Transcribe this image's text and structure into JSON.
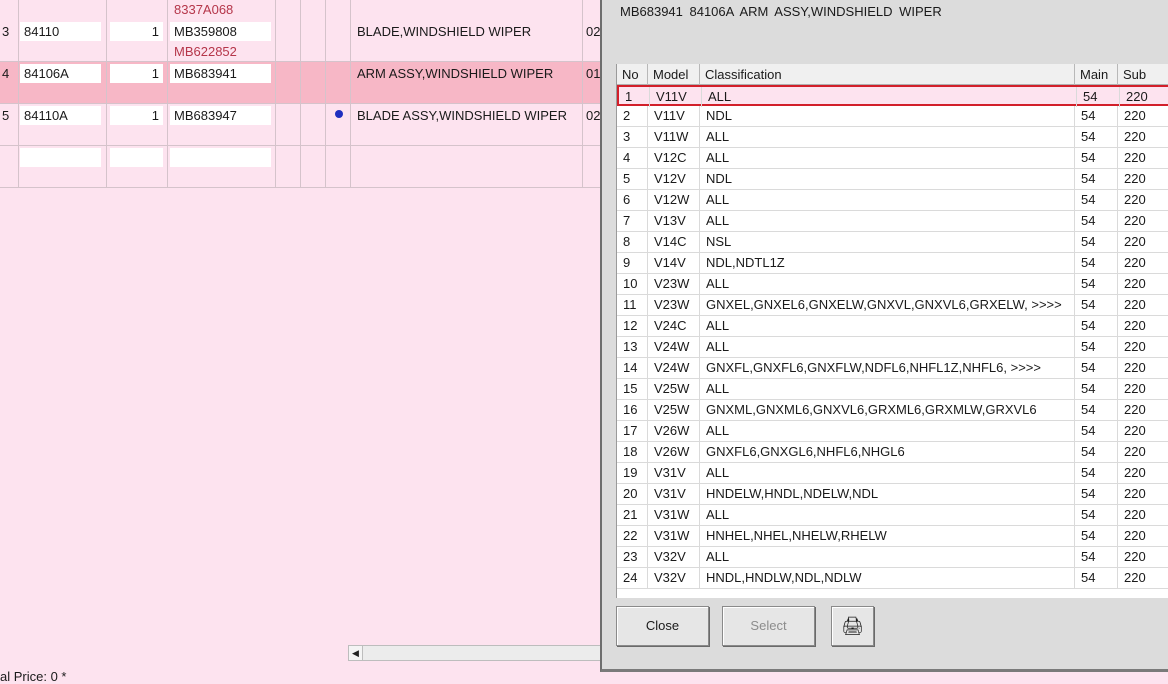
{
  "parts_grid": {
    "top_alternates": [
      "8337A068"
    ],
    "rows": [
      {
        "no": "3",
        "part_code": "84110",
        "qty": "1",
        "part_number": "MB359808",
        "alternates": [
          "MB622852"
        ],
        "has_marker": false,
        "description": "BLADE,WINDSHIELD WIPER",
        "trailing": "02",
        "selected": false
      },
      {
        "no": "4",
        "part_code": "84106A",
        "qty": "1",
        "part_number": "MB683941",
        "alternates": [],
        "has_marker": false,
        "description": "ARM ASSY,WINDSHIELD WIPER",
        "trailing": "01",
        "selected": true
      },
      {
        "no": "5",
        "part_code": "84110A",
        "qty": "1",
        "part_number": "MB683947",
        "alternates": [],
        "has_marker": true,
        "description": "BLADE ASSY,WINDSHIELD WIPER",
        "trailing": "02",
        "selected": false
      },
      {
        "no": "",
        "part_code": "",
        "qty": "",
        "part_number": "",
        "alternates": [],
        "has_marker": false,
        "description": "",
        "trailing": "",
        "selected": false
      }
    ]
  },
  "footer": {
    "total_price": "al Price: 0 *"
  },
  "dialog": {
    "header": "MB683941   84106A   ARM ASSY,WINDSHIELD WIPER",
    "columns": {
      "no": "No",
      "model": "Model",
      "classification": "Classification",
      "main": "Main",
      "sub": "Sub"
    },
    "rows": [
      {
        "no": "1",
        "model": "V11V",
        "classification": "ALL",
        "main": "54",
        "sub": "220"
      },
      {
        "no": "2",
        "model": "V11V",
        "classification": "NDL",
        "main": "54",
        "sub": "220"
      },
      {
        "no": "3",
        "model": "V11W",
        "classification": "ALL",
        "main": "54",
        "sub": "220"
      },
      {
        "no": "4",
        "model": "V12C",
        "classification": "ALL",
        "main": "54",
        "sub": "220"
      },
      {
        "no": "5",
        "model": "V12V",
        "classification": "NDL",
        "main": "54",
        "sub": "220"
      },
      {
        "no": "6",
        "model": "V12W",
        "classification": "ALL",
        "main": "54",
        "sub": "220"
      },
      {
        "no": "7",
        "model": "V13V",
        "classification": "ALL",
        "main": "54",
        "sub": "220"
      },
      {
        "no": "8",
        "model": "V14C",
        "classification": "NSL",
        "main": "54",
        "sub": "220"
      },
      {
        "no": "9",
        "model": "V14V",
        "classification": "NDL,NDTL1Z",
        "main": "54",
        "sub": "220"
      },
      {
        "no": "10",
        "model": "V23W",
        "classification": "ALL",
        "main": "54",
        "sub": "220"
      },
      {
        "no": "11",
        "model": "V23W",
        "classification": "GNXEL,GNXEL6,GNXELW,GNXVL,GNXVL6,GRXELW,  >>>>",
        "main": "54",
        "sub": "220"
      },
      {
        "no": "12",
        "model": "V24C",
        "classification": "ALL",
        "main": "54",
        "sub": "220"
      },
      {
        "no": "13",
        "model": "V24W",
        "classification": "ALL",
        "main": "54",
        "sub": "220"
      },
      {
        "no": "14",
        "model": "V24W",
        "classification": "GNXFL,GNXFL6,GNXFLW,NDFL6,NHFL1Z,NHFL6,  >>>>",
        "main": "54",
        "sub": "220"
      },
      {
        "no": "15",
        "model": "V25W",
        "classification": "ALL",
        "main": "54",
        "sub": "220"
      },
      {
        "no": "16",
        "model": "V25W",
        "classification": "GNXML,GNXML6,GNXVL6,GRXML6,GRXMLW,GRXVL6",
        "main": "54",
        "sub": "220"
      },
      {
        "no": "17",
        "model": "V26W",
        "classification": "ALL",
        "main": "54",
        "sub": "220"
      },
      {
        "no": "18",
        "model": "V26W",
        "classification": "GNXFL6,GNXGL6,NHFL6,NHGL6",
        "main": "54",
        "sub": "220"
      },
      {
        "no": "19",
        "model": "V31V",
        "classification": "ALL",
        "main": "54",
        "sub": "220"
      },
      {
        "no": "20",
        "model": "V31V",
        "classification": "HNDELW,HNDL,NDELW,NDL",
        "main": "54",
        "sub": "220"
      },
      {
        "no": "21",
        "model": "V31W",
        "classification": "ALL",
        "main": "54",
        "sub": "220"
      },
      {
        "no": "22",
        "model": "V31W",
        "classification": "HNHEL,NHEL,NHELW,RHELW",
        "main": "54",
        "sub": "220"
      },
      {
        "no": "23",
        "model": "V32V",
        "classification": "ALL",
        "main": "54",
        "sub": "220"
      },
      {
        "no": "24",
        "model": "V32V",
        "classification": "HNDL,HNDLW,NDL,NDLW",
        "main": "54",
        "sub": "220"
      }
    ],
    "selected_row": 0,
    "buttons": {
      "close": "Close",
      "select": "Select",
      "print_icon": "printer-icon"
    }
  }
}
